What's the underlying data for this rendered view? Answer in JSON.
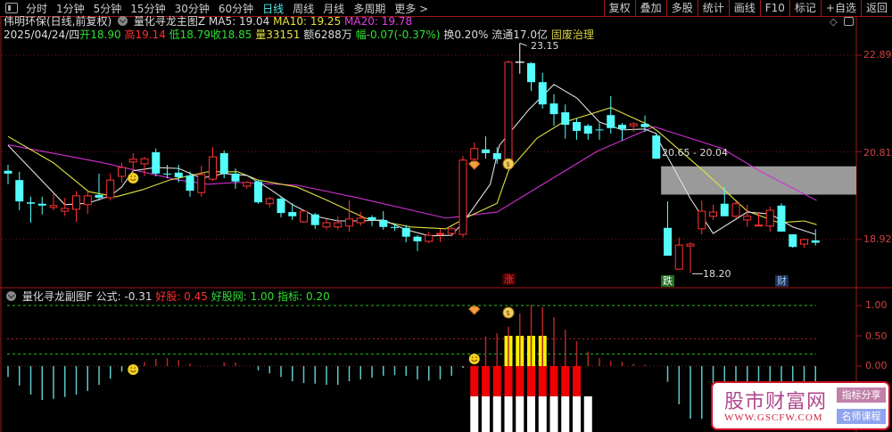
{
  "toolbar": {
    "tabs": [
      "分时",
      "1分钟",
      "5分钟",
      "15分钟",
      "30分钟",
      "60分钟",
      "日线",
      "周线",
      "月线",
      "多周期",
      "更多 >"
    ],
    "active_tab": "日线",
    "right_buttons": [
      "复权",
      "叠加",
      "多股",
      "统计",
      "画线",
      "F10",
      "标记",
      "+自选",
      "返回"
    ]
  },
  "header": {
    "stock": "伟明环保(日线,前复权)",
    "indicator": "量化寻龙主图Z",
    "ma5": "MA5: 19.04",
    "ma10": "MA10: 19.25",
    "ma20": "MA20: 19.78",
    "date": "2025/04/24/四",
    "open_label": "开",
    "open": "18.90",
    "high_label": "高",
    "high": "19.14",
    "low_label": "低",
    "low": "18.79",
    "close_label": "收",
    "close": "18.85",
    "vol_label": "量",
    "vol": "33151",
    "amount": "额6288万",
    "change_label": "幅",
    "change": "-0.07(-0.37%)",
    "turnover": "换0.20%",
    "float": "流通17.0亿",
    "sector": "固废治理"
  },
  "price_axis": [
    "22.89",
    "20.81",
    "18.92"
  ],
  "annotations": {
    "high": "23.15",
    "low": "18.20",
    "zone": "20.65 - 20.04",
    "rise": "涨",
    "fall": "跌",
    "finance": "财"
  },
  "sub": {
    "title": "量化寻龙副图F",
    "formula": "公式: -0.31",
    "good": "好股: 0.45",
    "goodnet": "好股网: 1.00",
    "index": "指标: 0.20",
    "axis": [
      "1.00",
      "0.50",
      "0.00"
    ]
  },
  "watermark": {
    "name": "股市财富网",
    "url": "WWW.GSCFW.COM",
    "tag1": "指标分享",
    "tag2": "名师课程"
  },
  "colors": {
    "up": "#ff3232",
    "down": "#54fcfc",
    "ma5": "#e0e0e0",
    "ma10": "#e0e040",
    "ma20": "#d030d0",
    "axis": "#a01818"
  },
  "chart_data": {
    "type": "candlestick",
    "price_range": [
      18.2,
      23.15
    ],
    "candles": [
      [
        20.4,
        20.53,
        20.11,
        20.34
      ],
      [
        20.2,
        20.38,
        19.55,
        19.74
      ],
      [
        19.72,
        19.84,
        19.28,
        19.69
      ],
      [
        19.69,
        19.84,
        19.46,
        19.65
      ],
      [
        19.61,
        19.9,
        19.55,
        19.65
      ],
      [
        19.53,
        19.82,
        19.42,
        19.59
      ],
      [
        19.57,
        19.96,
        19.3,
        19.86
      ],
      [
        19.67,
        19.96,
        19.47,
        19.86
      ],
      [
        19.88,
        20.34,
        19.76,
        19.82
      ],
      [
        19.82,
        20.34,
        19.76,
        20.2
      ],
      [
        20.28,
        20.57,
        20.15,
        20.47
      ],
      [
        20.59,
        20.78,
        20.34,
        20.65
      ],
      [
        20.55,
        20.7,
        20.28,
        20.66
      ],
      [
        20.8,
        20.88,
        20.28,
        20.34
      ],
      [
        20.34,
        20.53,
        20.24,
        20.32
      ],
      [
        20.36,
        20.53,
        20.15,
        20.26
      ],
      [
        20.3,
        20.38,
        19.84,
        19.97
      ],
      [
        19.93,
        20.51,
        19.84,
        20.32
      ],
      [
        20.22,
        20.91,
        20.18,
        20.7
      ],
      [
        20.78,
        20.84,
        20.24,
        20.34
      ],
      [
        20.34,
        20.45,
        20.01,
        20.17
      ],
      [
        20.07,
        20.18,
        20.01,
        20.15
      ],
      [
        20.17,
        20.2,
        19.69,
        19.72
      ],
      [
        19.69,
        19.84,
        19.61,
        19.8
      ],
      [
        19.8,
        19.86,
        19.4,
        19.49
      ],
      [
        19.51,
        19.7,
        19.34,
        19.42
      ],
      [
        19.3,
        19.53,
        19.28,
        19.53
      ],
      [
        19.46,
        19.49,
        19.15,
        19.23
      ],
      [
        19.19,
        19.36,
        19.13,
        19.28
      ],
      [
        19.19,
        19.42,
        19.13,
        19.28
      ],
      [
        19.21,
        19.76,
        19.09,
        19.36
      ],
      [
        19.28,
        19.51,
        19.21,
        19.38
      ],
      [
        19.4,
        19.44,
        19.21,
        19.34
      ],
      [
        19.34,
        19.53,
        19.13,
        19.19
      ],
      [
        19.19,
        19.26,
        19.11,
        19.17
      ],
      [
        19.17,
        19.23,
        18.86,
        18.98
      ],
      [
        18.98,
        19.01,
        18.67,
        18.88
      ],
      [
        18.88,
        19.09,
        18.84,
        19.01
      ],
      [
        19.03,
        19.15,
        18.86,
        19.05
      ],
      [
        19.05,
        19.21,
        18.98,
        19.15
      ],
      [
        19.03,
        20.72,
        18.96,
        20.63
      ],
      [
        20.65,
        21.01,
        20.55,
        20.88
      ],
      [
        20.86,
        21.14,
        20.66,
        20.78
      ],
      [
        20.78,
        20.91,
        20.55,
        20.65
      ],
      [
        20.63,
        22.78,
        20.59,
        22.74
      ],
      [
        22.74,
        23.15,
        22.49,
        22.74
      ],
      [
        22.72,
        22.74,
        22.12,
        22.31
      ],
      [
        22.31,
        22.51,
        21.74,
        21.83
      ],
      [
        21.85,
        22.05,
        21.37,
        21.62
      ],
      [
        21.66,
        21.83,
        21.09,
        21.39
      ],
      [
        21.45,
        21.53,
        21.07,
        21.26
      ],
      [
        21.37,
        21.41,
        21.07,
        21.2
      ],
      [
        21.29,
        21.43,
        21.07,
        21.28
      ],
      [
        21.6,
        22.01,
        21.2,
        21.32
      ],
      [
        21.39,
        21.43,
        21.05,
        21.3
      ],
      [
        21.37,
        21.45,
        21.24,
        21.41
      ],
      [
        21.41,
        21.59,
        21.24,
        21.34
      ],
      [
        21.16,
        21.2,
        20.66,
        20.66
      ],
      [
        19.17,
        19.74,
        18.57,
        18.57
      ],
      [
        18.28,
        18.96,
        18.28,
        18.8
      ],
      [
        18.78,
        18.86,
        18.2,
        18.82
      ],
      [
        19.15,
        19.76,
        19.03,
        19.53
      ],
      [
        19.42,
        19.67,
        19.34,
        19.51
      ],
      [
        19.69,
        20.05,
        19.42,
        19.42
      ],
      [
        19.42,
        19.74,
        19.38,
        19.69
      ],
      [
        19.34,
        19.67,
        19.19,
        19.42
      ],
      [
        19.21,
        19.51,
        19.21,
        19.23
      ],
      [
        19.21,
        19.63,
        19.09,
        19.55
      ],
      [
        19.65,
        19.7,
        19.09,
        19.09
      ],
      [
        19.03,
        19.03,
        18.74,
        18.76
      ],
      [
        18.82,
        18.94,
        18.74,
        18.92
      ],
      [
        18.9,
        19.14,
        18.79,
        18.85
      ]
    ],
    "ma5": [
      [
        0,
        20.95
      ],
      [
        5,
        19.67
      ],
      [
        7,
        19.7
      ],
      [
        9,
        19.86
      ],
      [
        10,
        20.05
      ],
      [
        11,
        20.4
      ],
      [
        13,
        20.47
      ],
      [
        15,
        20.45
      ],
      [
        17,
        20.24
      ],
      [
        19,
        20.34
      ],
      [
        21,
        20.3
      ],
      [
        23,
        20.01
      ],
      [
        25,
        19.67
      ],
      [
        27,
        19.42
      ],
      [
        29,
        19.32
      ],
      [
        31,
        19.32
      ],
      [
        33,
        19.34
      ],
      [
        35,
        19.13
      ],
      [
        37,
        19.0
      ],
      [
        39,
        19.01
      ],
      [
        40,
        19.28
      ],
      [
        42.4,
        20.11
      ],
      [
        43.2,
        20.95
      ],
      [
        45.8,
        21.72
      ],
      [
        48,
        22.26
      ],
      [
        50,
        21.97
      ],
      [
        52,
        21.45
      ],
      [
        54,
        21.28
      ],
      [
        56,
        21.3
      ],
      [
        57,
        21.2
      ],
      [
        57.3,
        21.01
      ],
      [
        60,
        19.8
      ],
      [
        62,
        19.05
      ],
      [
        65,
        19.51
      ],
      [
        67,
        19.47
      ],
      [
        69,
        19.19
      ],
      [
        71,
        19.03
      ]
    ],
    "ma10": [
      [
        0,
        21.14
      ],
      [
        4,
        20.57
      ],
      [
        7.1,
        19.95
      ],
      [
        9.5,
        19.84
      ],
      [
        11.8,
        19.99
      ],
      [
        14.2,
        20.2
      ],
      [
        17.6,
        20.38
      ],
      [
        20.2,
        20.38
      ],
      [
        22,
        20.2
      ],
      [
        25.4,
        20.05
      ],
      [
        28.1,
        19.76
      ],
      [
        31.4,
        19.38
      ],
      [
        35.4,
        19.19
      ],
      [
        38.5,
        19.15
      ],
      [
        40.2,
        19.38
      ],
      [
        43,
        19.7
      ],
      [
        44,
        20.4
      ],
      [
        46.5,
        21.1
      ],
      [
        48.7,
        21.43
      ],
      [
        53,
        21.76
      ],
      [
        56.3,
        21.39
      ],
      [
        57.1,
        21.26
      ],
      [
        61,
        20.43
      ],
      [
        65,
        19.53
      ],
      [
        67.8,
        19.28
      ],
      [
        70,
        19.32
      ],
      [
        71.1,
        19.24
      ]
    ],
    "ma20": [
      [
        0,
        20.96
      ],
      [
        8,
        20.59
      ],
      [
        15,
        20.2
      ],
      [
        17.6,
        20.11
      ],
      [
        20.2,
        20.15
      ],
      [
        25.4,
        20.09
      ],
      [
        30.7,
        19.82
      ],
      [
        38.5,
        19.38
      ],
      [
        43,
        19.51
      ],
      [
        51.8,
        20.82
      ],
      [
        56.8,
        21.35
      ],
      [
        62.8,
        20.88
      ],
      [
        66.2,
        20.38
      ],
      [
        71.1,
        19.76
      ]
    ],
    "zone": {
      "from_index": 57.5,
      "top": 20.65,
      "bottom": 20.04
    },
    "signals": {
      "smiley_main": 11,
      "diamond": 41,
      "moneybag": 44,
      "rise_index": 44,
      "fall_index": 58,
      "finance_index": 68
    },
    "sub_values": [
      -0.18,
      -0.32,
      -0.47,
      -0.56,
      -0.54,
      -0.51,
      -0.47,
      -0.41,
      -0.31,
      -0.21,
      -0.09,
      0,
      0.07,
      0.12,
      0.13,
      0.1,
      0.04,
      0.01,
      0.01,
      0.06,
      0.06,
      0,
      -0.07,
      -0.12,
      -0.18,
      -0.25,
      -0.28,
      -0.29,
      -0.31,
      -0.31,
      -0.25,
      -0.22,
      -0.19,
      -0.16,
      -0.15,
      -0.16,
      -0.22,
      -0.24,
      -0.22,
      -0.16,
      -0.03,
      0,
      0.49,
      0.54,
      0.65,
      0.87,
      1.01,
      0.97,
      0.81,
      0.6,
      0.41,
      0.24,
      0.13,
      0.09,
      0.07,
      0.04,
      0.02,
      0,
      -0.26,
      -0.63,
      -0.87,
      -0.87,
      -0.8,
      -0.75,
      -0.7,
      -0.65,
      -0.6,
      -0.55,
      -0.5,
      -0.45,
      -0.42,
      -0.31
    ],
    "sub_levels": {
      "goodnet": 1.0,
      "good": 0.45,
      "index": 0.2
    },
    "sub_range": [
      -1.1,
      1.0
    ],
    "blocks": {
      "white": [
        41,
        42,
        43,
        44,
        45,
        46,
        47,
        48,
        49,
        50,
        51
      ],
      "red": [
        41,
        42,
        43,
        44,
        45,
        46,
        47,
        48,
        49,
        50
      ],
      "yellow": [
        44,
        45,
        46,
        47
      ]
    }
  }
}
